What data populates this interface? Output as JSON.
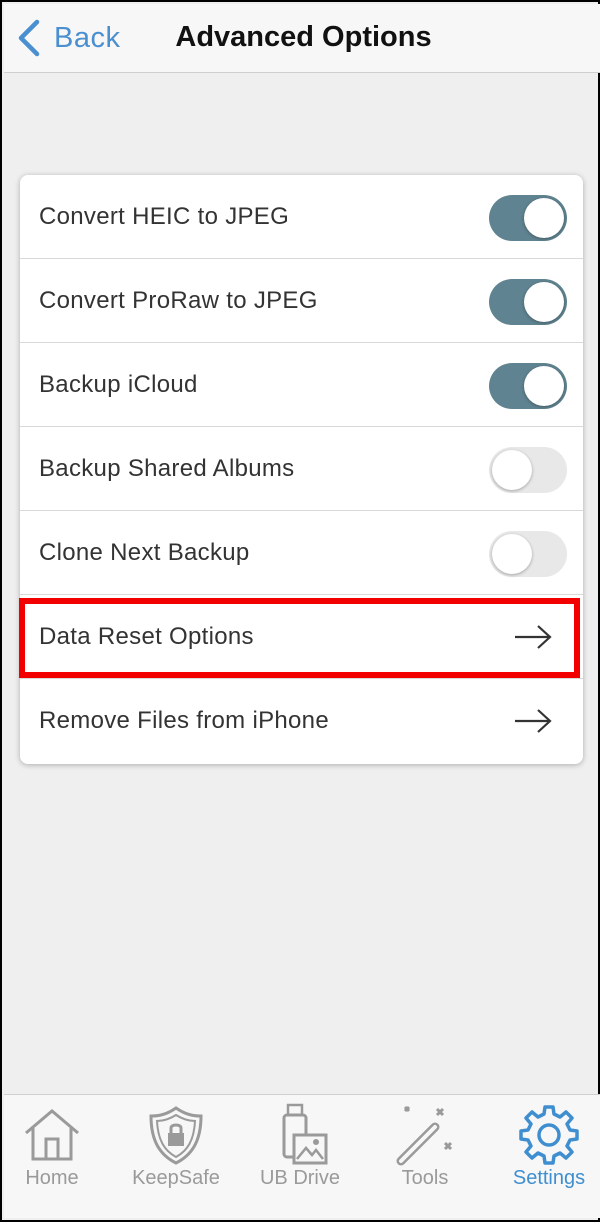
{
  "header": {
    "back_label": "Back",
    "title": "Advanced Options"
  },
  "settings": [
    {
      "label": "Convert HEIC to JPEG",
      "control": "toggle",
      "on": true
    },
    {
      "label": "Convert ProRaw to JPEG",
      "control": "toggle",
      "on": true
    },
    {
      "label": "Backup iCloud",
      "control": "toggle",
      "on": true
    },
    {
      "label": "Backup Shared Albums",
      "control": "toggle",
      "on": false
    },
    {
      "label": "Clone Next Backup",
      "control": "toggle",
      "on": false
    },
    {
      "label": "Data Reset Options",
      "control": "arrow-right-icon",
      "highlighted": true
    },
    {
      "label": "Remove Files from iPhone",
      "control": "arrow-right-icon"
    }
  ],
  "tabbar": {
    "tabs": [
      {
        "label": "Home",
        "icon": "home-icon",
        "active": false
      },
      {
        "label": "KeepSafe",
        "icon": "shield-lock-icon",
        "active": false
      },
      {
        "label": "UB Drive",
        "icon": "usb-drive-icon",
        "active": false
      },
      {
        "label": "Tools",
        "icon": "magic-wand-icon",
        "active": false
      },
      {
        "label": "Settings",
        "icon": "gear-icon",
        "active": true
      }
    ]
  },
  "colors": {
    "accent": "#3f8fd0",
    "toggle_on": "#5f8390",
    "toggle_off": "#e8e8e8",
    "highlight": "#f20000",
    "inactive_tab": "#9a9a9a"
  }
}
